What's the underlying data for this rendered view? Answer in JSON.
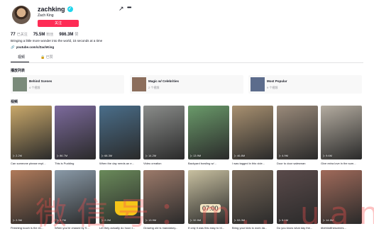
{
  "profile": {
    "username": "zachking",
    "nickname": "Zach King",
    "follow_label": "关注",
    "stats": [
      {
        "value": "77",
        "label": "已关注"
      },
      {
        "value": "75.5M",
        "label": "粉丝"
      },
      {
        "value": "986.3M",
        "label": "赞"
      }
    ],
    "bio": "Bringing a little more wonder into the world, 15 seconds at a time",
    "link": "youtube.com/c/ZachKing"
  },
  "tabs": [
    {
      "label": "视频",
      "active": true
    },
    {
      "label": "已赞",
      "active": false
    }
  ],
  "sections": {
    "playlists_title": "播放列表",
    "videos_title": "视频"
  },
  "playlists": [
    {
      "name": "Behind Scenes",
      "count": "4 个视频",
      "color": "#7a8a7a"
    },
    {
      "name": "Magic w/ Celebrities",
      "count": "2 个视频",
      "color": "#8c6e5c"
    },
    {
      "name": "Most Popular",
      "count": "9 个视频",
      "color": "#5c6c8c"
    }
  ],
  "videos_row1": [
    {
      "views": "2.2M",
      "caption": "Can someone please expl...",
      "color": "#c9a86a"
    },
    {
      "views": "86.7M",
      "caption": "This is Pudding",
      "color": "#7c6a9c"
    },
    {
      "views": "68.3M",
      "caption": "When the day needs an e...",
      "color": "#4a6e8a"
    },
    {
      "views": "14.2M",
      "caption": "Video creation",
      "color": "#8a8c8a"
    },
    {
      "views": "13.9M",
      "caption": "Backyard bowling w/...",
      "color": "#6a9a6a"
    },
    {
      "views": "46.8M",
      "caption": "I was tagged in this vide...",
      "color": "#a89070"
    },
    {
      "views": "4.9M",
      "caption": "Door to door salesman",
      "color": "#9a8a7a"
    },
    {
      "views": "9.6M",
      "caption": "Give extra love in the sum...",
      "color": "#b4aca0"
    }
  ],
  "videos_row2": [
    {
      "views": "2.3M",
      "caption": "Finishing touch is the #1...",
      "color": "#b07a5a"
    },
    {
      "views": "3.7M",
      "caption": "When you're chased by S...",
      "color": "#8a9aa8"
    },
    {
      "views": "2.2M",
      "caption": "Let they actually do hoon t...",
      "color": "#6a8a5a"
    },
    {
      "views": "13.9M",
      "caption": "Growing old is mandatory...",
      "color": "#9c7a6a"
    },
    {
      "views": "32.5M",
      "caption": "If only it was this easy to bl...",
      "color": "#c8c0a0"
    },
    {
      "views": "53.3M",
      "caption": "Bring your kids to work da...",
      "color": "#7a6a5a"
    },
    {
      "views": "5.1M",
      "caption": "Do you know what day the...",
      "color": "#5a4a4a"
    },
    {
      "views": "14.5M",
      "caption": "#behindthescenes...",
      "color": "#a06a5a"
    }
  ],
  "watermark": "微信号：m...uan...",
  "clock_text": "07:00",
  "icons": {
    "share": "share-icon",
    "more": "more-icon",
    "link": "link-icon",
    "play": "play-icon",
    "verified": "verified-icon"
  },
  "colors": {
    "accent": "#fe2c55",
    "verified": "#20d5ec"
  }
}
